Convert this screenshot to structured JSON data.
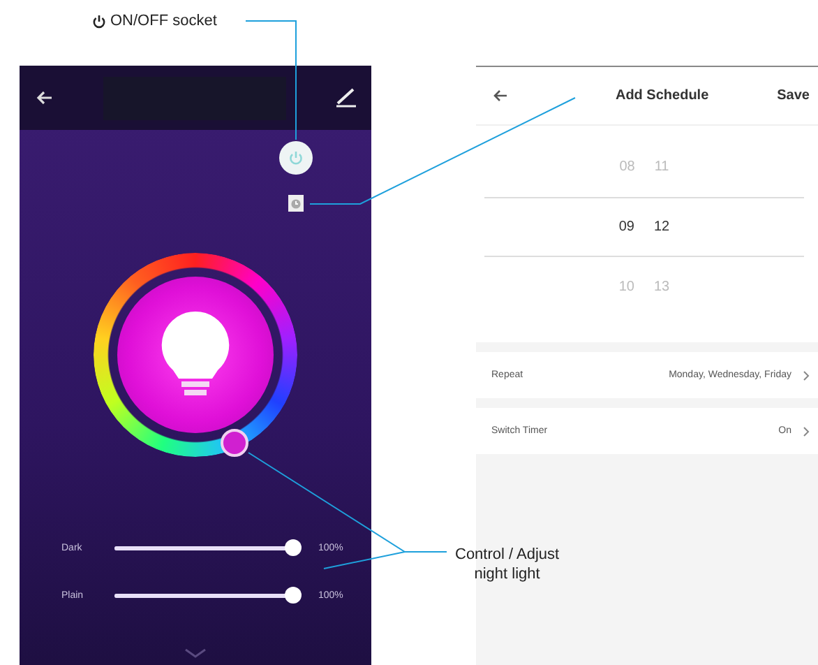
{
  "annotations": [
    {
      "kind": "power",
      "lines": [
        "ON/OFF socket"
      ]
    },
    {
      "kind": "night",
      "lines": [
        "Control / Adjust",
        "night light"
      ]
    }
  ],
  "light_screen": {
    "sliders": [
      {
        "label": "Dark",
        "level": 1,
        "reading": "100%"
      },
      {
        "label": "Plain",
        "level": 1,
        "reading": "100%"
      }
    ]
  },
  "schedule_screen": {
    "title": "Add Schedule",
    "action": "Save",
    "picker": [
      {
        "hour": "08",
        "minute": "11",
        "selected": false
      },
      {
        "hour": "09",
        "minute": "12",
        "selected": true
      },
      {
        "hour": "10",
        "minute": "13",
        "selected": false
      }
    ],
    "settings": [
      {
        "label": "Repeat",
        "value": "Monday, Wednesday, Friday"
      },
      {
        "label": "Switch Timer",
        "value": "On"
      }
    ]
  }
}
